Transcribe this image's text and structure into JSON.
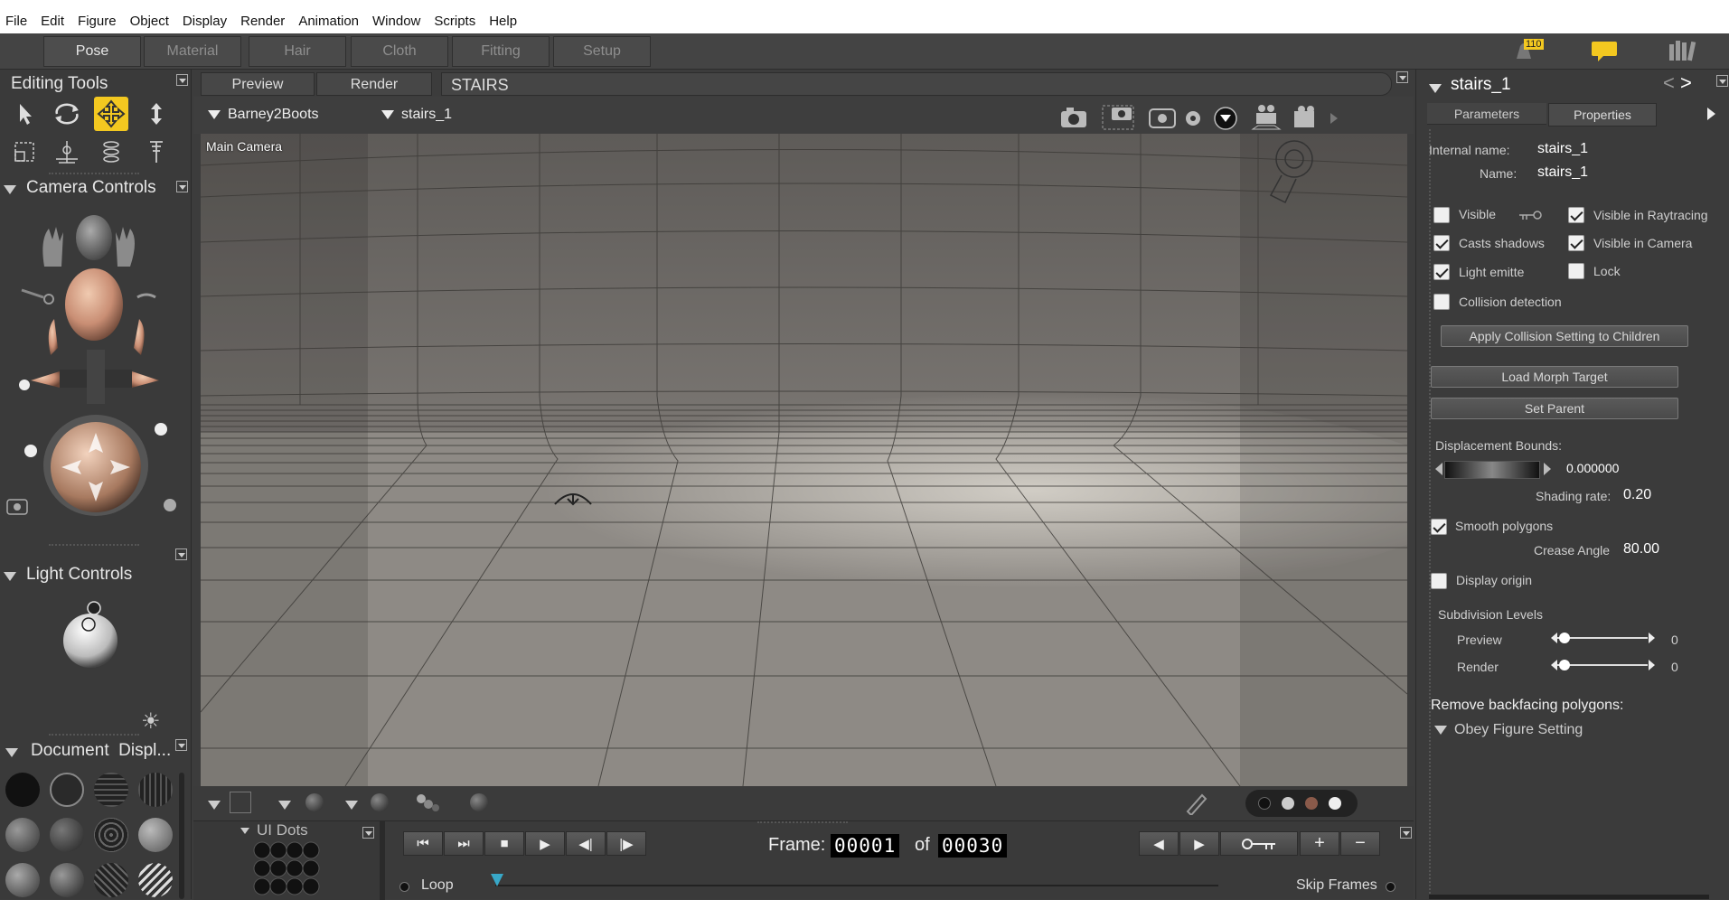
{
  "menu": [
    "File",
    "Edit",
    "Figure",
    "Object",
    "Display",
    "Render",
    "Animation",
    "Window",
    "Scripts",
    "Help"
  ],
  "rooms": [
    "Pose",
    "Material",
    "Hair",
    "Cloth",
    "Fitting",
    "Setup"
  ],
  "notifications": {
    "count": "110"
  },
  "editing_tools": {
    "title": "Editing Tools"
  },
  "camera_controls": {
    "title": "Camera Controls"
  },
  "light_controls": {
    "title": "Light Controls"
  },
  "document_display": {
    "title": "Document  Displ..."
  },
  "ui_dots": {
    "title": "UI Dots"
  },
  "view": {
    "tab_preview": "Preview",
    "tab_render": "Render",
    "doc_title": "STAIRS",
    "figure_select": "Barney2Boots",
    "actor_select": "stairs_1",
    "camera_label": "Main Camera"
  },
  "animation": {
    "frame_label": "Frame:",
    "frame_current": "00001",
    "of_label": "of",
    "frame_total": "00030",
    "loop_label": "Loop",
    "skip_frames_label": "Skip Frames"
  },
  "properties": {
    "header": "stairs_1",
    "tab_parameters": "Parameters",
    "tab_properties": "Properties",
    "internal_name_label": "Internal name:",
    "internal_name": "stairs_1",
    "name_label": "Name:",
    "name": "stairs_1",
    "visible": "Visible",
    "visible_raytracing": "Visible in Raytracing",
    "casts_shadows": "Casts shadows",
    "visible_camera": "Visible in Camera",
    "light_emitter": "Light emitte",
    "lock": "Lock",
    "collision_detection": "Collision detection",
    "apply_collision": "Apply Collision Setting to Children",
    "load_morph": "Load Morph Target",
    "set_parent": "Set Parent",
    "displacement_label": "Displacement Bounds:",
    "displacement_value": "0.000000",
    "shading_label": "Shading rate:",
    "shading_value": "0.20",
    "smooth_polygons": "Smooth polygons",
    "crease_label": "Crease Angle",
    "crease_value": "80.00",
    "display_origin": "Display origin",
    "subdivision_label": "Subdivision Levels",
    "preview_label": "Preview",
    "preview_value": "0",
    "render_label": "Render",
    "render_value": "0",
    "backfacing_label": "Remove backfacing polygons:",
    "backfacing_value": "Obey Figure Setting"
  },
  "colors": {
    "accent": "#f3c820",
    "timeline_marker": "#38a8c8"
  }
}
